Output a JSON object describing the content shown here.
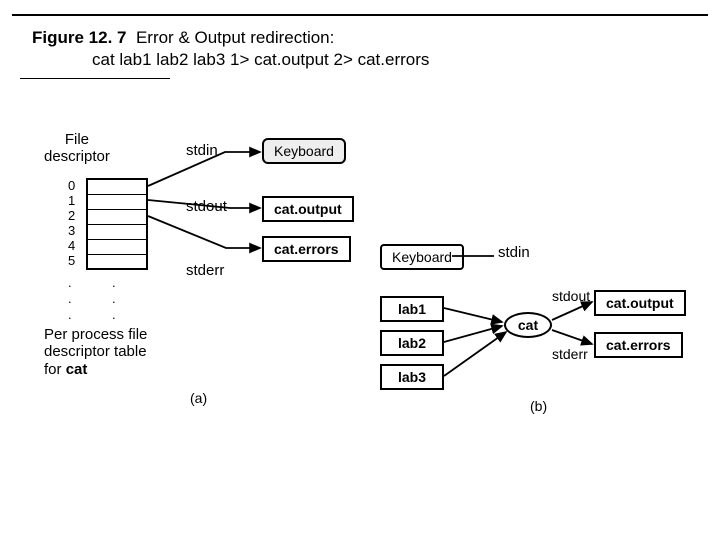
{
  "figure": {
    "number": "Figure 12. 7",
    "title": "Error & Output redirection:",
    "command": "cat lab1 lab2 lab3 1> cat.output 2> cat.errors"
  },
  "partA": {
    "fd_label_line1": "File",
    "fd_label_line2": "descriptor",
    "fd_numbers": [
      "0",
      "1",
      "2",
      "3",
      "4",
      "5",
      "."
    ],
    "streams": {
      "stdin": "stdin",
      "stdout": "stdout",
      "stderr": "stderr"
    },
    "boxes": {
      "keyboard": "Keyboard",
      "cat_output": "cat.output",
      "cat_errors": "cat.errors"
    },
    "perprocess_line1": "Per process file",
    "perprocess_line2": "descriptor table",
    "perprocess_line3": "for ",
    "perprocess_cat": "cat",
    "label": "(a)"
  },
  "partB": {
    "boxes": {
      "keyboard": "Keyboard",
      "lab1": "lab1",
      "lab2": "lab2",
      "lab3": "lab3",
      "cat": "cat",
      "cat_output": "cat.output",
      "cat_errors": "cat.errors"
    },
    "streams": {
      "stdin": "stdin",
      "stdout": "stdout",
      "stderr": "stderr"
    },
    "label": "(b)"
  }
}
